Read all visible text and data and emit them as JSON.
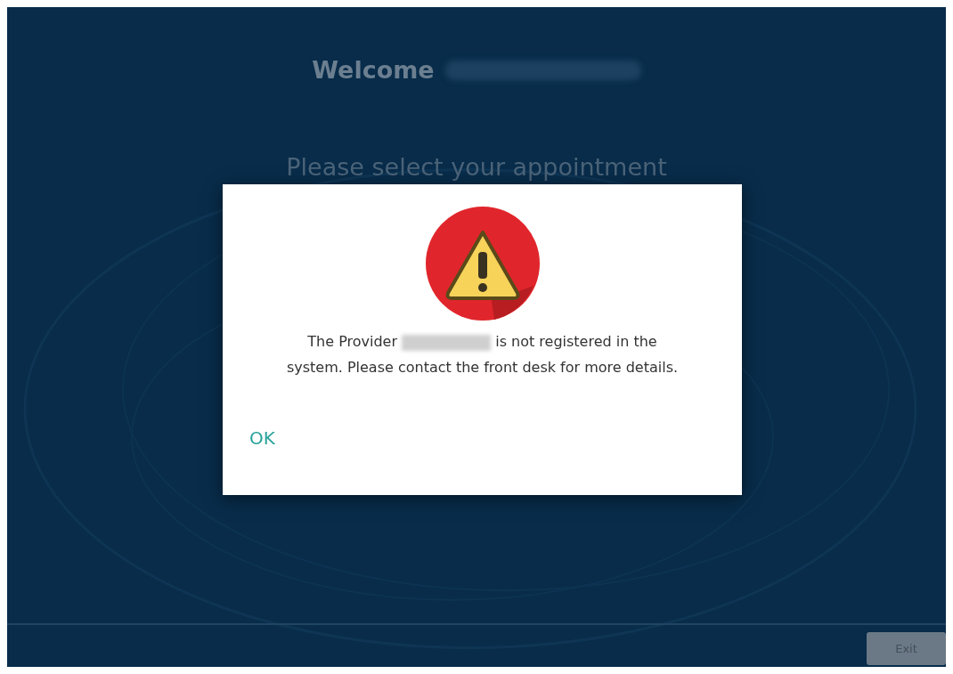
{
  "screen": {
    "heading": "Welcome",
    "heading_name_redacted": true,
    "prompt": "Please select your appointment"
  },
  "dialog": {
    "kind": "warning",
    "message_start": "The Provider",
    "provider_redacted": true,
    "message_end": "is not registered in the system. Please contact the front desk for more details.",
    "button": "OK"
  },
  "footer": {
    "button": "Exit",
    "button_disabled": true
  }
}
